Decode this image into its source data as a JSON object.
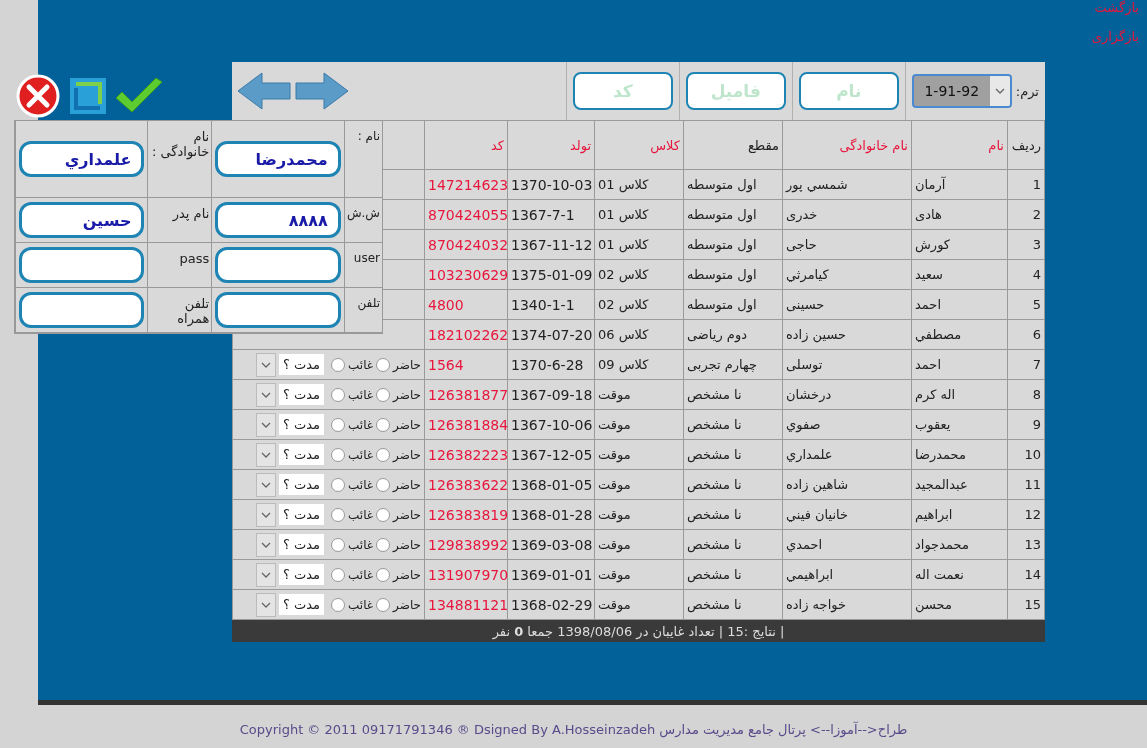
{
  "top_links": [
    "بازگشت",
    "بازگزاری"
  ],
  "toolbar": {
    "term_label": "ترم:",
    "term_value": "1-91-92",
    "buttons": [
      "نام",
      "فامیل",
      "کد"
    ]
  },
  "table": {
    "columns": [
      {
        "label": "ردیف",
        "link": false
      },
      {
        "label": "نام",
        "link": true
      },
      {
        "label": "نام خانوادگی",
        "link": true
      },
      {
        "label": "مقطع",
        "link": false
      },
      {
        "label": "کلاس",
        "link": true
      },
      {
        "label": "تولد",
        "link": true
      },
      {
        "label": "کد",
        "link": true
      }
    ],
    "rows": [
      {
        "n": "1",
        "first": "آرمان",
        "last": "شمسي پور",
        "level": "اول متوسطه",
        "class": "كلاس 01",
        "birth": "1370-10-03",
        "code": "147214623"
      },
      {
        "n": "2",
        "first": "هادی",
        "last": "خدری",
        "level": "اول متوسطه",
        "class": "كلاس 01",
        "birth": "1367-7-1",
        "code": "870424055"
      },
      {
        "n": "3",
        "first": "کورش",
        "last": "حاجی",
        "level": "اول متوسطه",
        "class": "كلاس 01",
        "birth": "1367-11-12",
        "code": "870424032"
      },
      {
        "n": "4",
        "first": "سعيد",
        "last": "كيامرثي",
        "level": "اول متوسطه",
        "class": "كلاس 02",
        "birth": "1375-01-09",
        "code": "103230629"
      },
      {
        "n": "5",
        "first": "احمد",
        "last": "حسینی",
        "level": "اول متوسطه",
        "class": "كلاس 02",
        "birth": "1340-1-1",
        "code": "4800"
      },
      {
        "n": "6",
        "first": "مصطفي",
        "last": "حسين زاده",
        "level": "دوم رياضی",
        "class": "كلاس 06",
        "birth": "1374-07-20",
        "code": "182102262"
      },
      {
        "n": "7",
        "first": "احمد",
        "last": "توسلی",
        "level": "چهارم تجربی",
        "class": "كلاس 09",
        "birth": "1370-6-28",
        "code": "1564",
        "attendance": {
          "options": [
            {
              "label": "حاضر",
              "selected": false
            },
            {
              "label": "غائب",
              "selected": false
            }
          ],
          "duration": "مدت ؟"
        }
      },
      {
        "n": "8",
        "first": "اله کرم",
        "last": "درخشان",
        "level": "نا مشخص",
        "class": "موقت",
        "birth": "1367-09-18",
        "code": "126381877",
        "attendance": {
          "options": [
            {
              "label": "حاضر",
              "selected": false
            },
            {
              "label": "غائب",
              "selected": false
            }
          ],
          "duration": "مدت ؟"
        }
      },
      {
        "n": "9",
        "first": "يعقوب",
        "last": "صفوي",
        "level": "نا مشخص",
        "class": "موقت",
        "birth": "1367-10-06",
        "code": "126381884",
        "attendance": {
          "options": [
            {
              "label": "حاضر",
              "selected": false
            },
            {
              "label": "غائب",
              "selected": false
            }
          ],
          "duration": "مدت ؟"
        }
      },
      {
        "n": "10",
        "first": "محمدرضا",
        "last": "علمداري",
        "level": "نا مشخص",
        "class": "موقت",
        "birth": "1367-12-05",
        "code": "126382223",
        "attendance": {
          "options": [
            {
              "label": "حاضر",
              "selected": false
            },
            {
              "label": "غائب",
              "selected": false
            }
          ],
          "duration": "مدت ؟"
        }
      },
      {
        "n": "11",
        "first": "عبدالمجيد",
        "last": "شاهين زاده",
        "level": "نا مشخص",
        "class": "موقت",
        "birth": "1368-01-05",
        "code": "126383622",
        "attendance": {
          "options": [
            {
              "label": "حاضر",
              "selected": false
            },
            {
              "label": "غائب",
              "selected": false
            }
          ],
          "duration": "مدت ؟"
        }
      },
      {
        "n": "12",
        "first": "ابراهيم",
        "last": "خانيان فيني",
        "level": "نا مشخص",
        "class": "موقت",
        "birth": "1368-01-28",
        "code": "126383819",
        "attendance": {
          "options": [
            {
              "label": "حاضر",
              "selected": false
            },
            {
              "label": "غائب",
              "selected": false
            }
          ],
          "duration": "مدت ؟"
        }
      },
      {
        "n": "13",
        "first": "محمدجواد",
        "last": "احمدي",
        "level": "نا مشخص",
        "class": "موقت",
        "birth": "1369-03-08",
        "code": "129838992",
        "attendance": {
          "options": [
            {
              "label": "حاضر",
              "selected": false
            },
            {
              "label": "غائب",
              "selected": false
            }
          ],
          "duration": "مدت ؟"
        }
      },
      {
        "n": "14",
        "first": "نعمت اله",
        "last": "ابراهيمي",
        "level": "نا مشخص",
        "class": "موقت",
        "birth": "1369-01-01",
        "code": "131907970",
        "attendance": {
          "options": [
            {
              "label": "حاضر",
              "selected": false
            },
            {
              "label": "غائب",
              "selected": false
            }
          ],
          "duration": "مدت ؟"
        }
      },
      {
        "n": "15",
        "first": "محسن",
        "last": "خواجه زاده",
        "level": "نا مشخص",
        "class": "موقت",
        "birth": "1368-02-29",
        "code": "134881121",
        "attendance": {
          "options": [
            {
              "label": "حاضر",
              "selected": false
            },
            {
              "label": "غائب",
              "selected": false
            }
          ],
          "duration": "مدت ؟"
        }
      }
    ],
    "status": "| نتايج :15 | تعداد غايبان در 1398/08/06 جمعا **0** نفر"
  },
  "edit_form": {
    "fields": [
      {
        "label": "نام :",
        "value": "محمدرضا"
      },
      {
        "label": "نام خانوادگی :",
        "value": "علمداري"
      },
      {
        "label": "ش.ش",
        "value": "۸۸۸۸"
      },
      {
        "label": "نام پدر",
        "value": "حسين"
      },
      {
        "label": "user"
      },
      {
        "label": "pass"
      },
      {
        "label": "تلفن"
      },
      {
        "label": "تلفن همراه"
      }
    ]
  },
  "footer": "طراح<--آموزا--> پرتال جامع مدیریت مدارس Copyright © 2011 09171791346 ® Dsigned By A.Hosseinzadeh"
}
